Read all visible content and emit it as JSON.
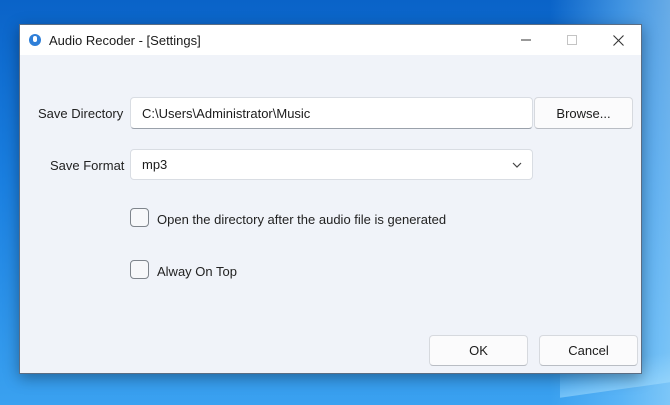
{
  "window": {
    "title": "Audio Recoder - [Settings]"
  },
  "form": {
    "save_directory_label": "Save Directory",
    "save_directory_value": "C:\\Users\\Administrator\\Music",
    "browse_label": "Browse...",
    "save_format_label": "Save Format",
    "save_format_value": "mp3",
    "open_dir_label": "Open the directory after the audio file is generated",
    "always_on_top_label": "Alway On Top"
  },
  "footer": {
    "ok_label": "OK",
    "cancel_label": "Cancel"
  },
  "icons": {
    "app": "microphone-icon",
    "minimize": "minimize-icon",
    "maximize": "maximize-icon",
    "close": "close-icon",
    "dropdown": "chevron-down-icon"
  },
  "colors": {
    "desktop": "#1a7fe0",
    "window_bg": "#f0f3f9",
    "accent": "#2f7fd8"
  }
}
